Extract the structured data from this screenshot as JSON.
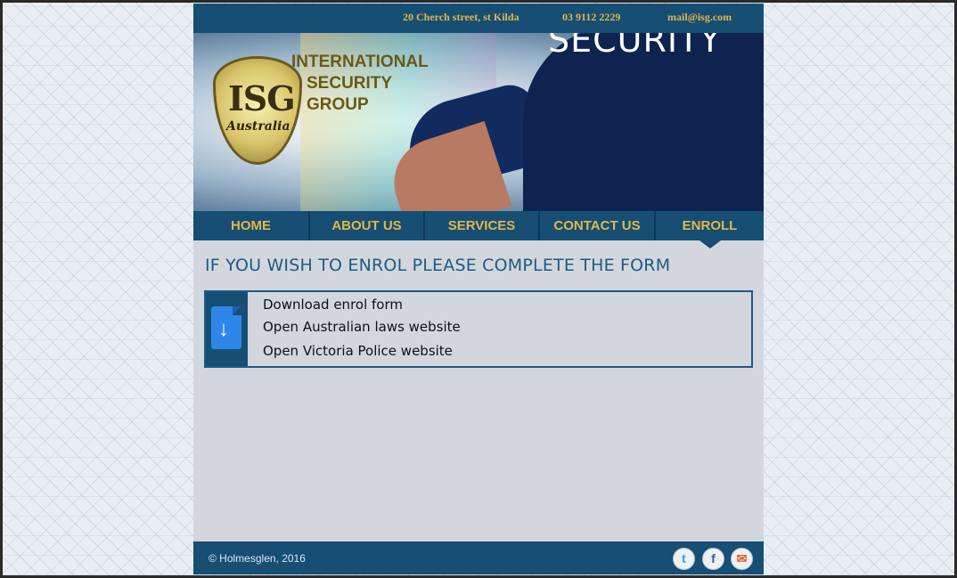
{
  "topbar": {
    "address": "20 Cherch street, st Kilda",
    "phone": "03 9112 2229",
    "email": "mail@isg.com"
  },
  "hero": {
    "shirt_text": "SECURITY",
    "logo_letters": "ISG",
    "logo_country": "Australia",
    "brand_line1": "INTERNATIONAL",
    "brand_line2": "SECURITY",
    "brand_line3": "GROUP"
  },
  "nav": {
    "items": [
      {
        "label": "HOME"
      },
      {
        "label": "ABOUT US"
      },
      {
        "label": "SERVICES"
      },
      {
        "label": "CONTACT US"
      },
      {
        "label": "ENROLL"
      }
    ],
    "active": "ENROLL"
  },
  "main": {
    "heading": "IF YOU WISH TO ENROL PLEASE COMPLETE THE FORM",
    "links": [
      {
        "label": "Download enrol form"
      },
      {
        "label": "Open Australian laws website"
      },
      {
        "label": "Open Victoria Police website"
      }
    ],
    "icon": "download-document-icon"
  },
  "footer": {
    "copyright": "© Holmesglen, 2016",
    "social": [
      "twitter-icon",
      "facebook-icon",
      "email-icon"
    ]
  },
  "colors": {
    "header_blue": "#164e74",
    "nav_text": "#e2b64a",
    "page_bg": "#d3d7dd",
    "heading_blue": "#1d5b86"
  }
}
